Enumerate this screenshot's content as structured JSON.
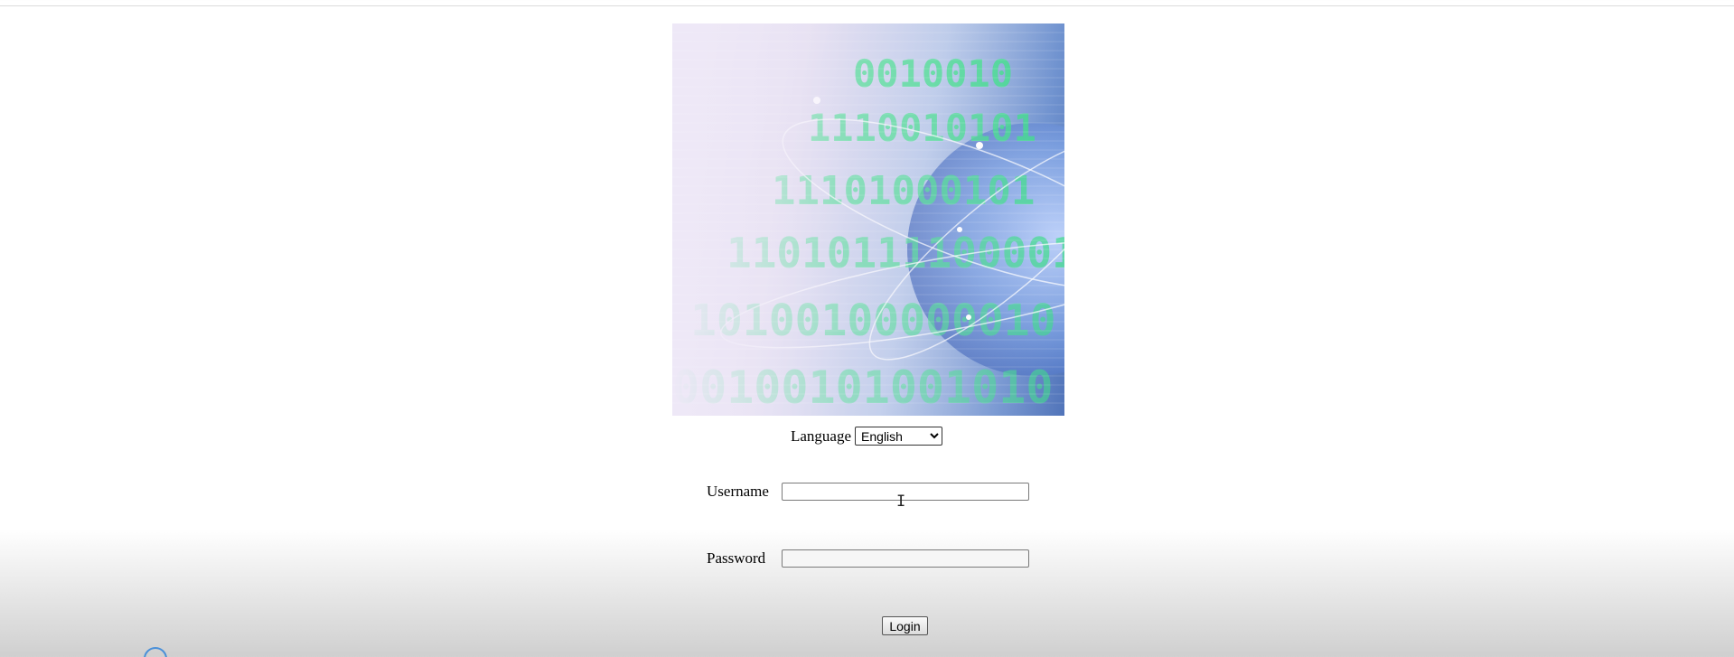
{
  "language": {
    "label": "Language",
    "selected": "English"
  },
  "username": {
    "label": "Username",
    "value": ""
  },
  "password": {
    "label": "Password",
    "value": ""
  },
  "login": {
    "button_label": "Login"
  },
  "icons": {
    "cursor": "text-cursor-icon",
    "corner": "circle-icon"
  },
  "colors": {
    "banner_accent": "#3ddc8a",
    "banner_blue": "#5174b9"
  }
}
